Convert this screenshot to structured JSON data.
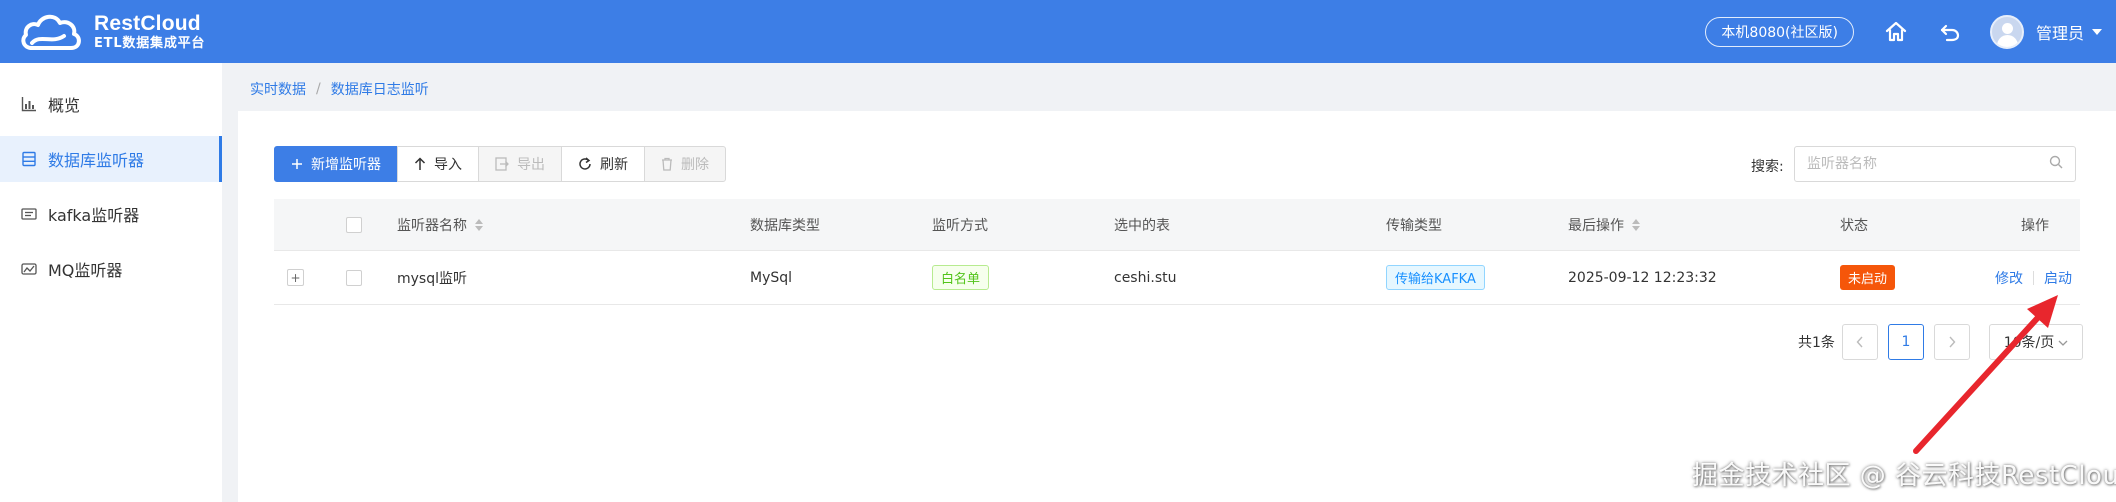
{
  "header": {
    "logo_title": "RestCloud",
    "logo_subtitle": "ETL数据集成平台",
    "env_label": "本机8080(社区版)",
    "user_name": "管理员",
    "brand_color": "#3d7ee6"
  },
  "sidebar": {
    "items": [
      {
        "label": "概览",
        "icon": "bar-chart-icon",
        "active": false
      },
      {
        "label": "数据库监听器",
        "icon": "database-list-icon",
        "active": true
      },
      {
        "label": "kafka监听器",
        "icon": "kafka-icon",
        "active": false
      },
      {
        "label": "MQ监听器",
        "icon": "mq-icon",
        "active": false
      }
    ]
  },
  "breadcrumb": [
    "实时数据",
    "数据库日志监听"
  ],
  "toolbar": {
    "add_label": "新增监听器",
    "import_label": "导入",
    "export_label": "导出",
    "refresh_label": "刷新",
    "delete_label": "删除"
  },
  "search": {
    "label": "搜索:",
    "placeholder": "监听器名称"
  },
  "table": {
    "columns": [
      "监听器名称",
      "数据库类型",
      "监听方式",
      "选中的表",
      "传输类型",
      "最后操作",
      "状态",
      "操作"
    ],
    "rows": [
      {
        "name": "mysql监听",
        "db_type": "MySql",
        "mode": "白名单",
        "tables": "ceshi.stu",
        "transfer": "传输给KAFKA",
        "last_op": "2025-09-12 12:23:32",
        "status": "未启动",
        "actions": [
          "修改",
          "启动"
        ]
      }
    ]
  },
  "pagination": {
    "total_label": "共1条",
    "current_page": "1",
    "page_size_label": "10条/页"
  },
  "watermark": "掘金技术社区 @ 谷云科技RestCloud",
  "colors": {
    "accent": "#2f7be6",
    "status_stopped": "#f5560a",
    "annotation_arrow": "#e8262d"
  }
}
